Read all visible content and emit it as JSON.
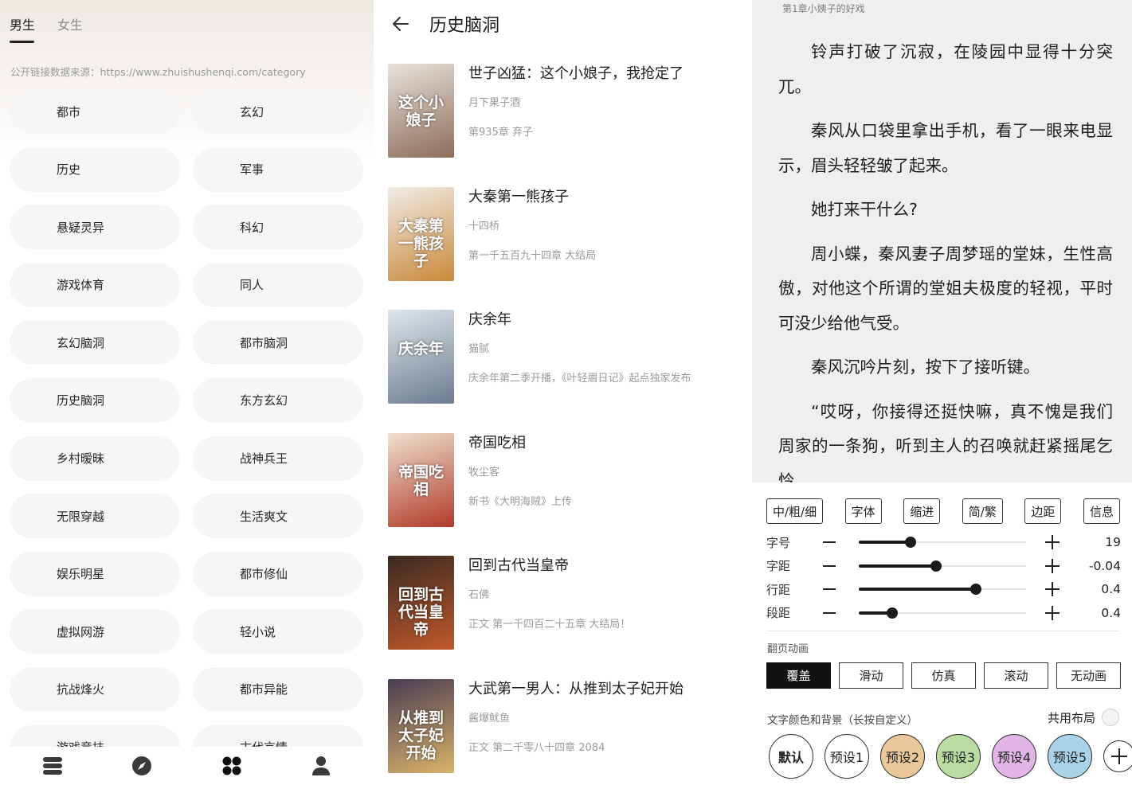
{
  "categories_panel": {
    "tabs": [
      {
        "label": "男生",
        "active": true
      },
      {
        "label": "女生",
        "active": false
      }
    ],
    "source_note": "公开链接数据来源：https://www.zhuishushenqi.com/category",
    "categories": [
      "都市",
      "玄幻",
      "历史",
      "军事",
      "悬疑灵异",
      "科幻",
      "游戏体育",
      "同人",
      "玄幻脑洞",
      "都市脑洞",
      "历史脑洞",
      "东方玄幻",
      "乡村暧昧",
      "战神兵王",
      "无限穿越",
      "生活爽文",
      "娱乐明星",
      "都市修仙",
      "虚拟网游",
      "轻小说",
      "抗战烽火",
      "都市异能",
      "游戏竞技",
      "古代言情"
    ],
    "bottom_nav": [
      {
        "icon": "bookshelf-icon",
        "active": false
      },
      {
        "icon": "compass-icon",
        "active": false
      },
      {
        "icon": "category-grid-icon",
        "active": true
      },
      {
        "icon": "profile-icon",
        "active": false
      }
    ],
    "colors": {
      "active_tab": "#1a1a1a",
      "pill_bg": "#f6f6f6"
    }
  },
  "book_list": {
    "title": "历史脑洞",
    "books": [
      {
        "title": "世子凶猛：这个小娘子，我抢定了",
        "author": "月下果子酒",
        "latest": "第935章  弃子",
        "cover_text": "这个小娘子",
        "cover_colors": [
          "#e9e3dc",
          "#8c6d5a"
        ]
      },
      {
        "title": "大秦第一熊孩子",
        "author": "十四桥",
        "latest": "第一千五百九十四章 大结局",
        "cover_text": "大秦第一熊孩子",
        "cover_colors": [
          "#f1ece6",
          "#c98a3b"
        ]
      },
      {
        "title": "庆余年",
        "author": "猫腻",
        "latest": "庆余年第二季开播，《叶轻眉日记》起点独家发布",
        "cover_text": "庆余年",
        "cover_colors": [
          "#dfe6ec",
          "#6b7c8f"
        ]
      },
      {
        "title": "帝国吃相",
        "author": "牧尘客",
        "latest": "新书《大明海贼》上传",
        "cover_text": "帝国吃相",
        "cover_colors": [
          "#eee2cf",
          "#b23a2a"
        ]
      },
      {
        "title": "回到古代当皇帝",
        "author": "石佛",
        "latest": "正文 第一千四百二十五章 大结局！",
        "cover_text": "回到古代当皇帝",
        "cover_colors": [
          "#3a2a22",
          "#c0592b"
        ]
      },
      {
        "title": "大武第一男人：从推到太子妃开始",
        "author": "酱爆鱿鱼",
        "latest": "正文 第二千零八十四章 2084",
        "cover_text": "从推到太子妃开始",
        "cover_colors": [
          "#4a3c52",
          "#d9b36a"
        ]
      }
    ]
  },
  "reader": {
    "chapter_title": "第1章小姨子的好戏",
    "paragraphs": [
      "铃声打破了沉寂，在陵园中显得十分突兀。",
      "秦风从口袋里拿出手机，看了一眼来电显示，眉头轻轻皱了起来。",
      "她打来干什么?",
      "周小蝶，秦风妻子周梦瑶的堂妹，生性高傲，对他这个所谓的堂姐夫极度的轻视，平时可没少给他气受。",
      "秦风沉吟片刻，按下了接听键。",
      "“哎呀，你接得还挺快嘛，真不愧是我们周家的一条狗，听到主人的召唤就赶紧摇尾乞怜。"
    ],
    "toolbar": [
      "中/粗/细",
      "字体",
      "缩进",
      "简/繁",
      "边距",
      "信息"
    ],
    "sliders": [
      {
        "label": "字号",
        "value": "19",
        "fraction": 0.31
      },
      {
        "label": "字距",
        "value": "-0.04",
        "fraction": 0.46
      },
      {
        "label": "行距",
        "value": "0.4",
        "fraction": 0.7
      },
      {
        "label": "段距",
        "value": "0.4",
        "fraction": 0.2
      }
    ],
    "animation_label": "翻页动画",
    "animations": [
      {
        "label": "覆盖",
        "selected": true
      },
      {
        "label": "滑动",
        "selected": false
      },
      {
        "label": "仿真",
        "selected": false
      },
      {
        "label": "滚动",
        "selected": false
      },
      {
        "label": "无动画",
        "selected": false
      }
    ],
    "color_label": "文字颜色和背景（长按自定义）",
    "shared_layout_label": "共用布局",
    "presets": [
      {
        "label": "默认",
        "bg": "#ffffff",
        "selected": true
      },
      {
        "label": "预设1",
        "bg": "#ffffff",
        "selected": false
      },
      {
        "label": "预设2",
        "bg": "#e9c79a",
        "selected": false
      },
      {
        "label": "预设3",
        "bg": "#b9dca2",
        "selected": false
      },
      {
        "label": "预设4",
        "bg": "#e2b5e6",
        "selected": false
      },
      {
        "label": "预设5",
        "bg": "#a8d3e9",
        "selected": false
      }
    ],
    "colors": {
      "reader_bg": "#efefef",
      "accent": "#111111"
    }
  }
}
